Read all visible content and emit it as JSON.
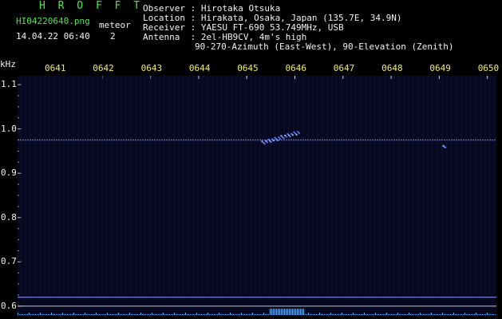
{
  "header": {
    "title": "H R O F F T",
    "filename": "HI04220640.png",
    "datetime": "14.04.22 06:40",
    "meteor_label": "meteor",
    "meteor_count": "2"
  },
  "info": {
    "observer": "Observer : Hirotaka Otsuka",
    "location": "Location : Hirakata, Osaka, Japan (135.7E, 34.9N)",
    "receiver": "Receiver : YAESU FT-690 53.749MHz, USB",
    "antenna": "Antenna  : 2el-HB9CV, 4m's high",
    "antenna2": "90-270-Azimuth (East-West), 90-Elevation (Zenith)"
  },
  "colors": {
    "label_green": "#48e848",
    "label_white": "#f2f2f2",
    "time_yellow": "#f0f060",
    "background": "#07081f",
    "signal": "#5d7cff",
    "reference_line": "#8aa0ff"
  },
  "chart_data": {
    "type": "heatmap",
    "ylabel": "kHz",
    "x_ticks": [
      "0641",
      "0642",
      "0643",
      "0644",
      "0645",
      "0646",
      "0647",
      "0648",
      "0649",
      "0650"
    ],
    "y_ticks": [
      "1.1",
      "1.0",
      "0.9",
      "0.8",
      "0.7",
      "0.6"
    ],
    "ylim": [
      0.58,
      1.12
    ],
    "carrier_khz": 0.975,
    "reference_lines_khz": [
      0.62,
      0.6
    ],
    "meteor_echoes": [
      {
        "time": "0645.7",
        "freq_khz_start": 0.97,
        "freq_khz_end": 0.995
      },
      {
        "time": "0649.1",
        "freq_khz_start": 0.96,
        "freq_khz_end": 0.965
      }
    ]
  }
}
